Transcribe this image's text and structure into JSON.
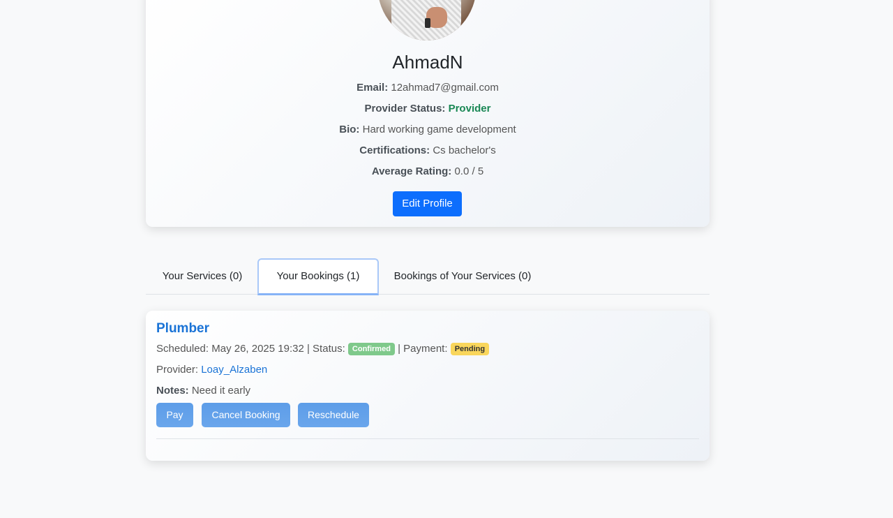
{
  "profile": {
    "name": "AhmadN",
    "email_label": "Email:",
    "email": "12ahmad7@gmail.com",
    "status_label": "Provider Status:",
    "status": "Provider",
    "bio_label": "Bio:",
    "bio": "Hard working game development",
    "cert_label": "Certifications:",
    "cert": "Cs bachelor's",
    "rating_label": "Average Rating:",
    "rating": "0.0 / 5",
    "edit_button": "Edit Profile"
  },
  "tabs": [
    {
      "label": "Your Services (0)"
    },
    {
      "label": "Your Bookings (1)",
      "active": true
    },
    {
      "label": "Bookings of Your Services (0)"
    }
  ],
  "booking": {
    "service": "Plumber",
    "scheduled_prefix": "Scheduled: May 26, 2025 19:32 | Status:",
    "status_badge": "Confirmed",
    "payment_prefix": "| Payment:",
    "payment_badge": "Pending",
    "provider_label": "Provider:",
    "provider": "Loay_Alzaben",
    "notes_label": "Notes:",
    "notes": "Need it early",
    "buttons": {
      "pay": "Pay",
      "cancel": "Cancel Booking",
      "reschedule": "Reschedule"
    }
  },
  "colors": {
    "primary": "#0d6efd",
    "status_green": "#198754",
    "link_blue": "#1a73d6",
    "badge_confirmed": "#7fc98b",
    "badge_pending": "#f9d65c"
  }
}
